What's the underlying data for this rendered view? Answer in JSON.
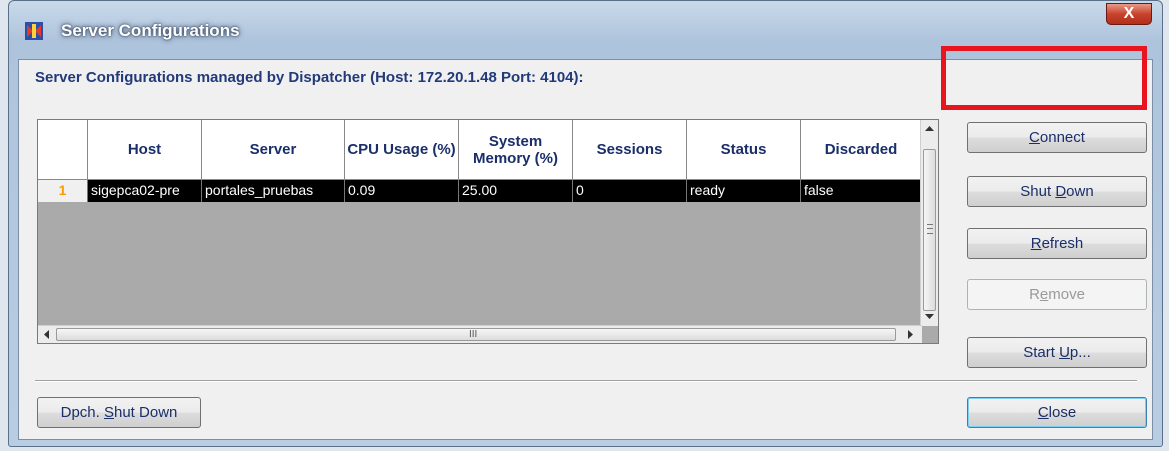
{
  "window": {
    "title": "Server Configurations",
    "close_glyph": "X"
  },
  "header_label": "Server Configurations managed by Dispatcher  (Host: 172.20.1.48 Port: 4104):",
  "table": {
    "columns": [
      "",
      "Host",
      "Server",
      "CPU Usage (%)",
      "System Memory (%)",
      "Sessions",
      "Status",
      "Discarded"
    ],
    "rows": [
      {
        "num": "1",
        "host": "sigepca02-pre",
        "server": "portales_pruebas",
        "cpu": "0.09",
        "memory": "25.00",
        "sessions": "0",
        "status": "ready",
        "discarded": "false"
      }
    ],
    "hscroll_grip": "III"
  },
  "buttons": {
    "connect": {
      "label": "Connect",
      "mnemonic": "C",
      "rest": "onnect"
    },
    "shutdown": {
      "label": "Shut Down",
      "pre": "Shut ",
      "mnemonic": "D",
      "rest": "own"
    },
    "refresh": {
      "label": "Refresh",
      "mnemonic": "R",
      "rest": "efresh"
    },
    "remove": {
      "label": "Remove",
      "pre": "R",
      "mnemonic": "e",
      "rest": "move"
    },
    "startup": {
      "label": "Start Up...",
      "pre": "Start ",
      "mnemonic": "U",
      "rest": "p..."
    },
    "dispatcher_shutdown": {
      "label": "Dpch. Shut Down",
      "pre": "Dpch. ",
      "mnemonic": "S",
      "rest": "hut Down"
    },
    "close": {
      "label": "Close",
      "mnemonic": "C",
      "rest": "lose"
    }
  },
  "colors": {
    "accent_highlight": "#e8141e",
    "label_blue": "#1a2f6a",
    "row_selected_bg": "#000000",
    "row_number": "#ff9a00"
  }
}
